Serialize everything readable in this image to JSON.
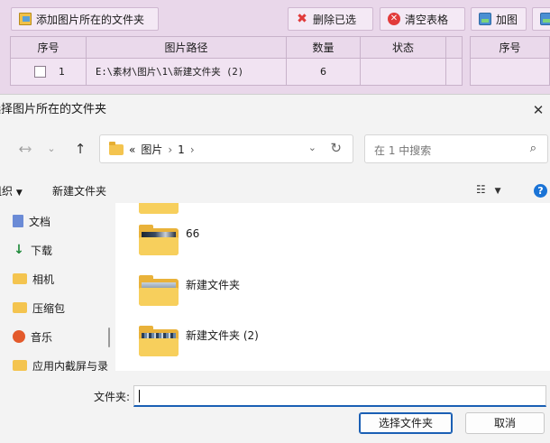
{
  "app": {
    "toolbar": {
      "add_folder": "添加图片所在的文件夹",
      "delete_selected": "删除已选",
      "clear_table": "清空表格",
      "add_image": "加图"
    },
    "table": {
      "headers": [
        "序号",
        "图片路径",
        "数量",
        "状态"
      ],
      "rows": [
        {
          "index": "1",
          "path": "E:\\素材\\图片\\1\\新建文件夹 (2)",
          "count": "6",
          "status": ""
        }
      ],
      "right_header": "序号"
    }
  },
  "dialog": {
    "title": "选择图片所在的文件夹",
    "nav": {
      "breadcrumb_overflow": "«",
      "breadcrumb": [
        "图片",
        "1"
      ],
      "search_placeholder": "在 1 中搜索"
    },
    "commands": {
      "organize": "组织",
      "new_folder": "新建文件夹"
    },
    "sidebar": [
      {
        "label": "文档",
        "icon": "document-icon"
      },
      {
        "label": "下载",
        "icon": "download-icon"
      },
      {
        "label": "相机",
        "icon": "folder-icon"
      },
      {
        "label": "压缩包",
        "icon": "folder-icon"
      },
      {
        "label": "音乐",
        "icon": "music-icon"
      },
      {
        "label": "应用内截屏与录",
        "icon": "folder-icon"
      }
    ],
    "folders": [
      {
        "name": "66"
      },
      {
        "name": "新建文件夹"
      },
      {
        "name": "新建文件夹 (2)"
      }
    ],
    "filename_label": "文件夹:",
    "filename_value": "",
    "select_button": "选择文件夹",
    "cancel_button": "取消"
  }
}
